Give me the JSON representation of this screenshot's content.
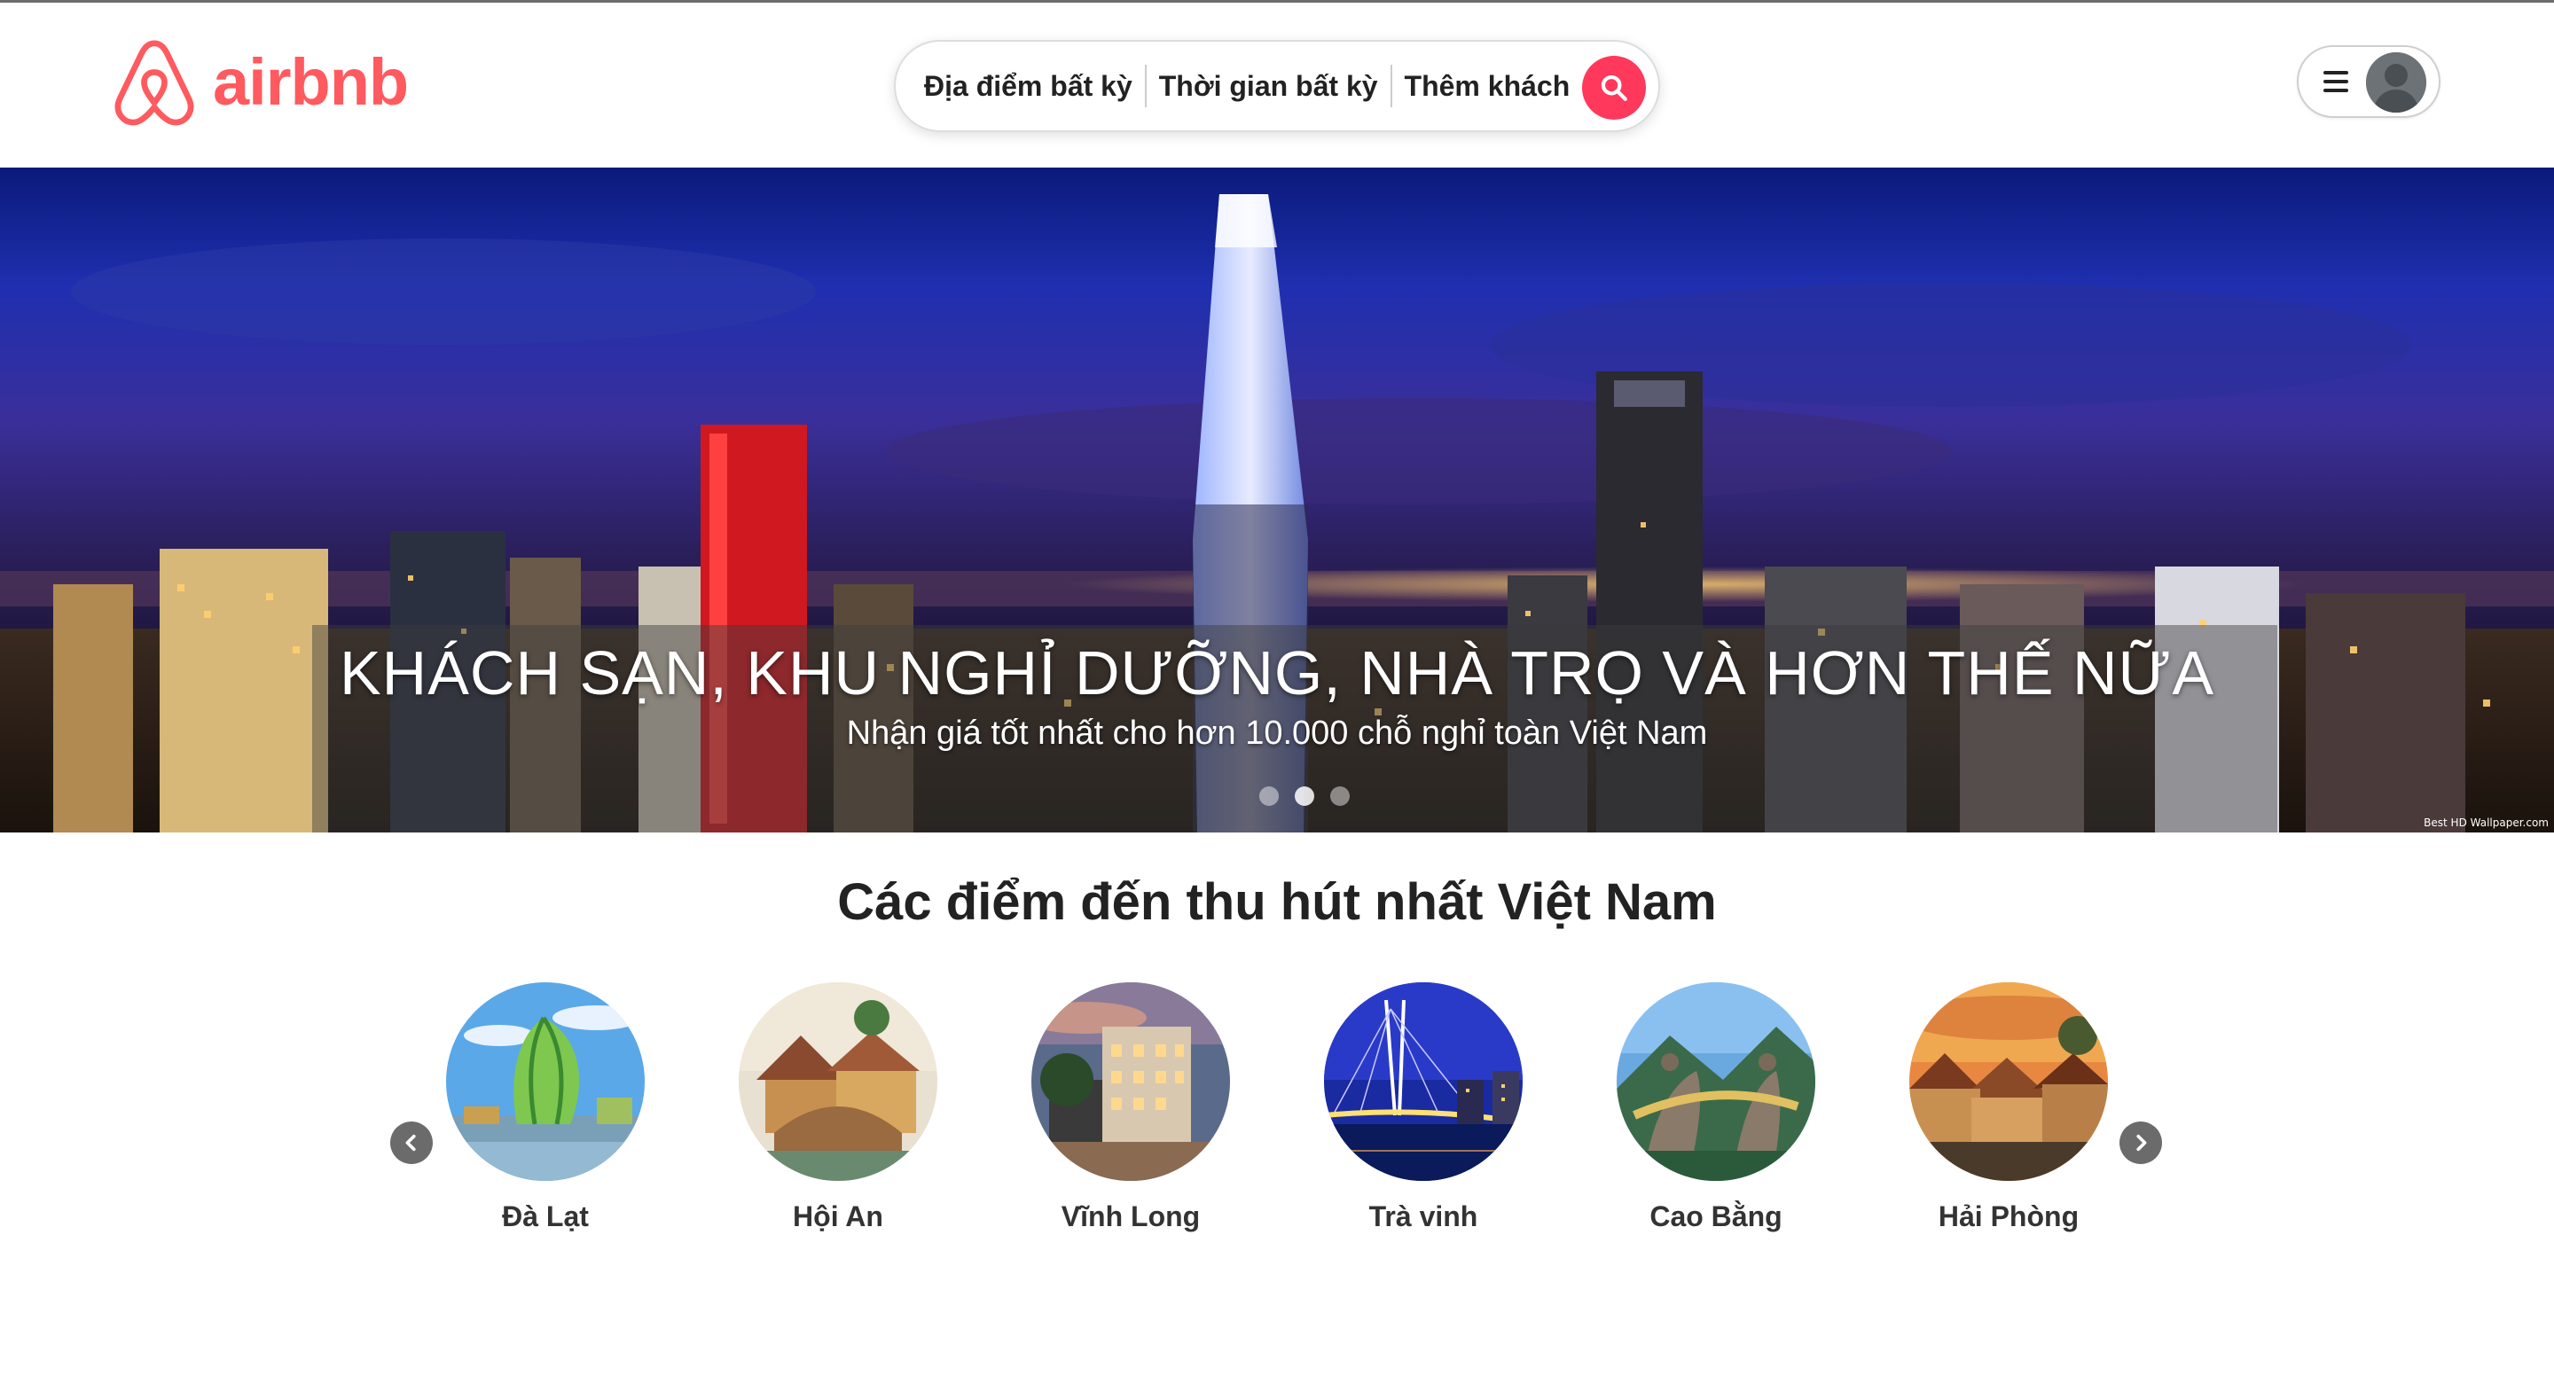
{
  "header": {
    "logo_text": "airbnb",
    "brand_color": "#ff5a5f",
    "search": {
      "location": "Địa điểm bất kỳ",
      "time": "Thời gian bất kỳ",
      "guests": "Thêm khách",
      "button_color": "#ff385c",
      "icon": "search-icon"
    },
    "user_menu": {
      "menu_icon": "hamburger-icon",
      "avatar_icon": "user-avatar-icon"
    }
  },
  "hero": {
    "title": "KHÁCH SẠN, KHU NGHỈ DƯỠNG, NHÀ TRỌ VÀ HƠN THẾ NỮA",
    "subtitle": "Nhận giá tốt nhất cho hơn 10.000 chỗ nghỉ toàn Việt Nam",
    "watermark": "Best HD Wallpaper.com",
    "slides": 3,
    "active_slide": 1
  },
  "destinations": {
    "title": "Các điểm đến thu hút nhất Việt Nam",
    "items": [
      {
        "name": "Đà Lạt"
      },
      {
        "name": "Hội An"
      },
      {
        "name": "Vĩnh Long"
      },
      {
        "name": "Trà vinh"
      },
      {
        "name": "Cao Bằng"
      },
      {
        "name": "Hải Phòng"
      }
    ],
    "prev_icon": "chevron-left-icon",
    "next_icon": "chevron-right-icon"
  }
}
